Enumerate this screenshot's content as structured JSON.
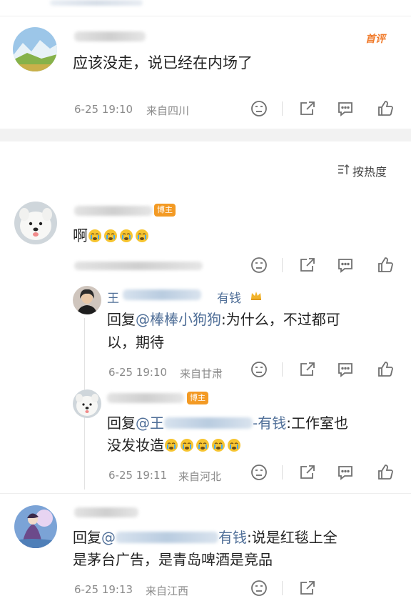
{
  "comments": [
    {
      "text": "应该没走，说已经在内场了",
      "time": "6-25 19:10",
      "location": "来自四川",
      "tag": "首评"
    },
    {
      "text": "啊",
      "author_badge": "博主"
    }
  ],
  "sort_label": "按热度",
  "replies": [
    {
      "name_visible_start": "王",
      "name_visible_end": "有钱",
      "reply_prefix": "回复",
      "mention": "@棒棒小狗狗",
      "text_line1": ":为什么，不过都可",
      "text_line2": "以，期待",
      "time": "6-25 19:10",
      "location": "来自甘肃"
    },
    {
      "author_badge": "博主",
      "reply_prefix": "回复",
      "mention_start": "@王",
      "mention_end": "-有钱",
      "text_line1": ":工作室也",
      "text_line2": "没发妆造",
      "time": "6-25 19:11",
      "location": "来自河北"
    }
  ],
  "last_comment": {
    "reply_prefix": "回复",
    "mention_start": "@",
    "mention_end": "有钱",
    "text_line1": ":说是红毯上全",
    "text_line2": "是茅台广告，是青岛啤酒是竞品",
    "time": "6-25 19:13",
    "location": "来自江西"
  },
  "colors": {
    "mention": "#506f98",
    "badge": "#f39a24",
    "first_tag": "#f07a2a"
  }
}
